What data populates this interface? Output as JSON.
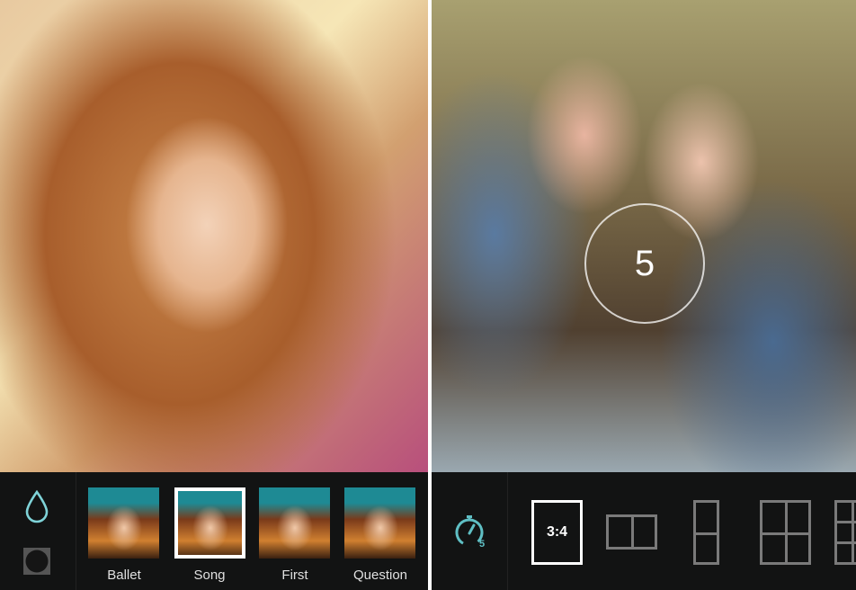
{
  "filter_screen": {
    "filters": [
      {
        "label": "Ballet",
        "selected": false
      },
      {
        "label": "Song",
        "selected": true
      },
      {
        "label": "First",
        "selected": false
      },
      {
        "label": "Question",
        "selected": false
      }
    ],
    "icons": {
      "tone": "droplet-icon",
      "vignette": "vignette-icon"
    },
    "accent": "#7fd3d8"
  },
  "camera_screen": {
    "countdown": "5",
    "timer_seconds": "5",
    "layouts": [
      {
        "label": "3:4",
        "selected": true
      },
      {
        "name": "two-horizontal"
      },
      {
        "name": "two-vertical"
      },
      {
        "name": "four-grid"
      },
      {
        "name": "six-grid"
      }
    ],
    "accent": "#5fbfc4"
  }
}
